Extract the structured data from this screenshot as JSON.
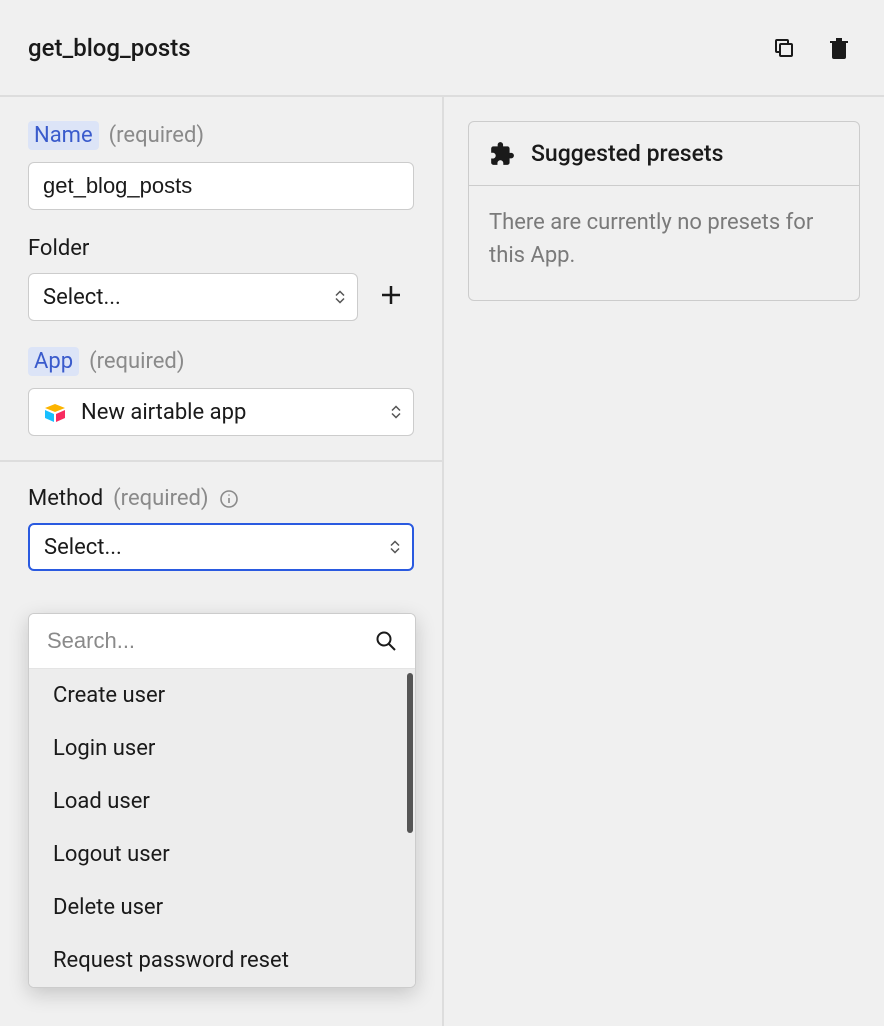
{
  "header": {
    "title": "get_blog_posts"
  },
  "form": {
    "name": {
      "label": "Name",
      "required": "(required)",
      "value": "get_blog_posts"
    },
    "folder": {
      "label": "Folder",
      "placeholder": "Select..."
    },
    "app": {
      "label": "App",
      "required": "(required)",
      "value": "New airtable app"
    },
    "method": {
      "label": "Method",
      "required": "(required)",
      "placeholder": "Select...",
      "search_placeholder": "Search...",
      "options": [
        "Create user",
        "Login user",
        "Load user",
        "Logout user",
        "Delete user",
        "Request password reset"
      ]
    }
  },
  "presets": {
    "title": "Suggested presets",
    "empty": "There are currently no presets for this App."
  }
}
